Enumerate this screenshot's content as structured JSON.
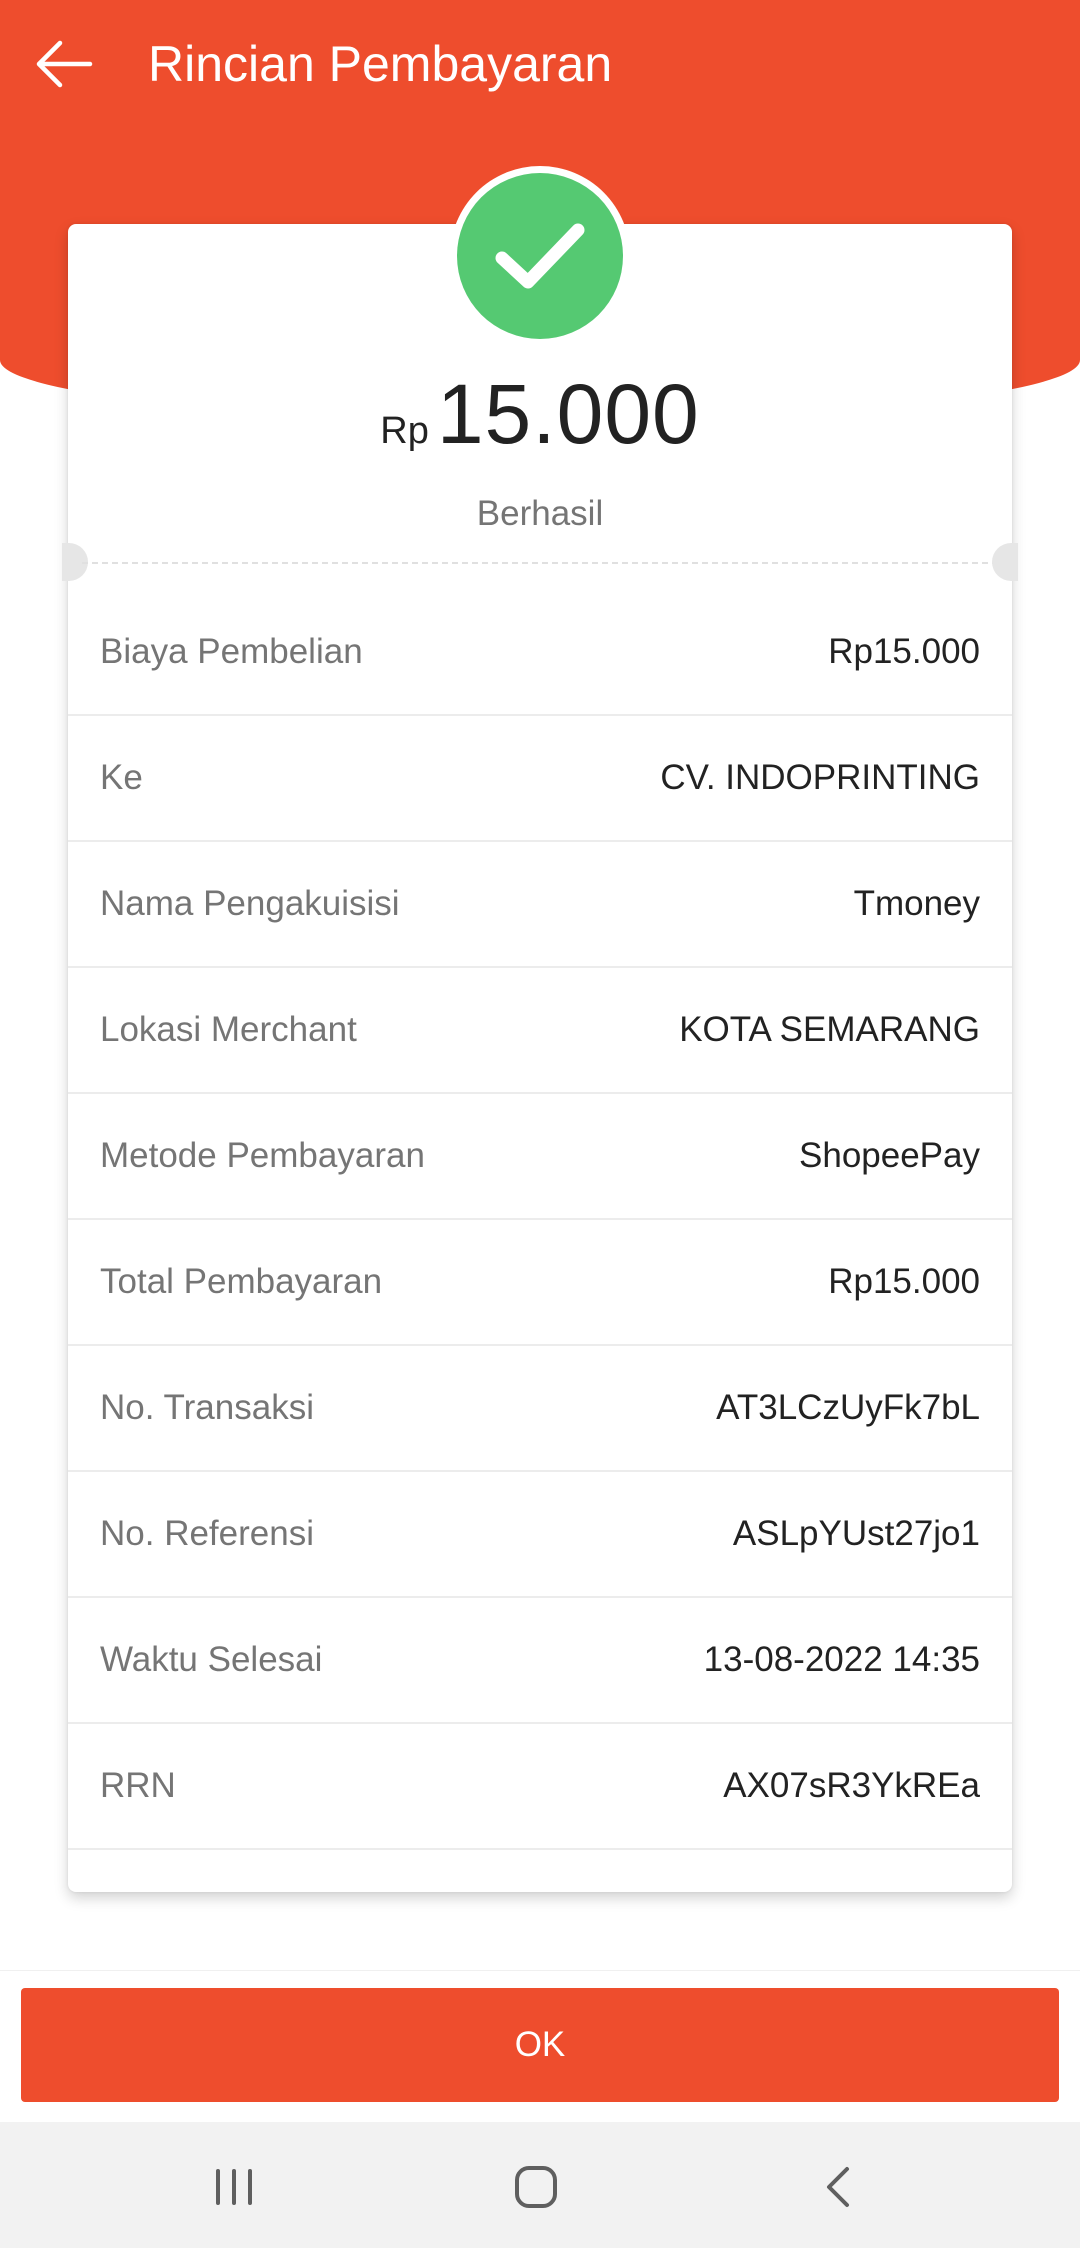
{
  "header": {
    "title": "Rincian Pembayaran",
    "back_icon": "arrow-left-icon",
    "color": "#ee4d2d"
  },
  "summary": {
    "status_icon": "check-circle-icon",
    "currency": "Rp",
    "amount": "15.000",
    "status": "Berhasil",
    "status_color": "#55c972"
  },
  "details": [
    {
      "label": "Biaya Pembelian",
      "value": "Rp15.000"
    },
    {
      "label": "Ke",
      "value": "CV. INDOPRINTING"
    },
    {
      "label": "Nama Pengakuisisi",
      "value": "Tmoney"
    },
    {
      "label": "Lokasi Merchant",
      "value": "KOTA SEMARANG"
    },
    {
      "label": "Metode Pembayaran",
      "value": "ShopeePay"
    },
    {
      "label": "Total Pembayaran",
      "value": "Rp15.000"
    },
    {
      "label": "No. Transaksi",
      "value": "AT3LCzUyFk7bL"
    },
    {
      "label": "No. Referensi",
      "value": "ASLpYUst27jo1"
    },
    {
      "label": "Waktu Selesai",
      "value": "13-08-2022 14:35"
    },
    {
      "label": "RRN",
      "value": "AX07sR3YkREa"
    }
  ],
  "footer": {
    "ok_label": "OK"
  },
  "system_nav": {
    "recents_icon": "recent-apps-icon",
    "home_icon": "home-icon",
    "back_icon": "back-chevron-icon"
  }
}
